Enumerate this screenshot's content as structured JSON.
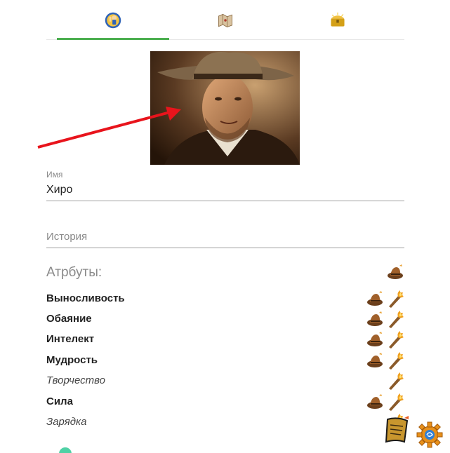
{
  "tabs": [
    {
      "icon": "vault-boy-icon"
    },
    {
      "icon": "map-icon"
    },
    {
      "icon": "treasure-chest-icon"
    }
  ],
  "profile": {
    "name_label": "Имя",
    "name_value": "Хиро",
    "history_placeholder": "История"
  },
  "attributes": {
    "title": "Атрбуты:",
    "header_icon": "add-item-icon",
    "rows": [
      {
        "label": "Выносливость",
        "style": "bold",
        "icons": [
          "hat-item-icon",
          "torch-item-icon"
        ]
      },
      {
        "label": "Обаяние",
        "style": "bold",
        "icons": [
          "hat-item-icon",
          "torch-item-icon"
        ]
      },
      {
        "label": "Интелект",
        "style": "bold",
        "icons": [
          "hat-item-icon",
          "torch-item-icon"
        ]
      },
      {
        "label": "Мудрость",
        "style": "bold",
        "icons": [
          "hat-item-icon",
          "torch-item-icon"
        ]
      },
      {
        "label": "Творчество",
        "style": "italic",
        "icons": [
          "torch-item-icon"
        ]
      },
      {
        "label": "Сила",
        "style": "bold",
        "icons": [
          "hat-item-icon",
          "torch-item-icon"
        ]
      },
      {
        "label": "Зарядка",
        "style": "italic",
        "icons": [
          "torch-item-icon"
        ]
      }
    ]
  },
  "footer_icons": [
    "scroll-icon",
    "gear-icon"
  ],
  "colors": {
    "accent": "#4caf50",
    "arrow": "#e8141c"
  }
}
